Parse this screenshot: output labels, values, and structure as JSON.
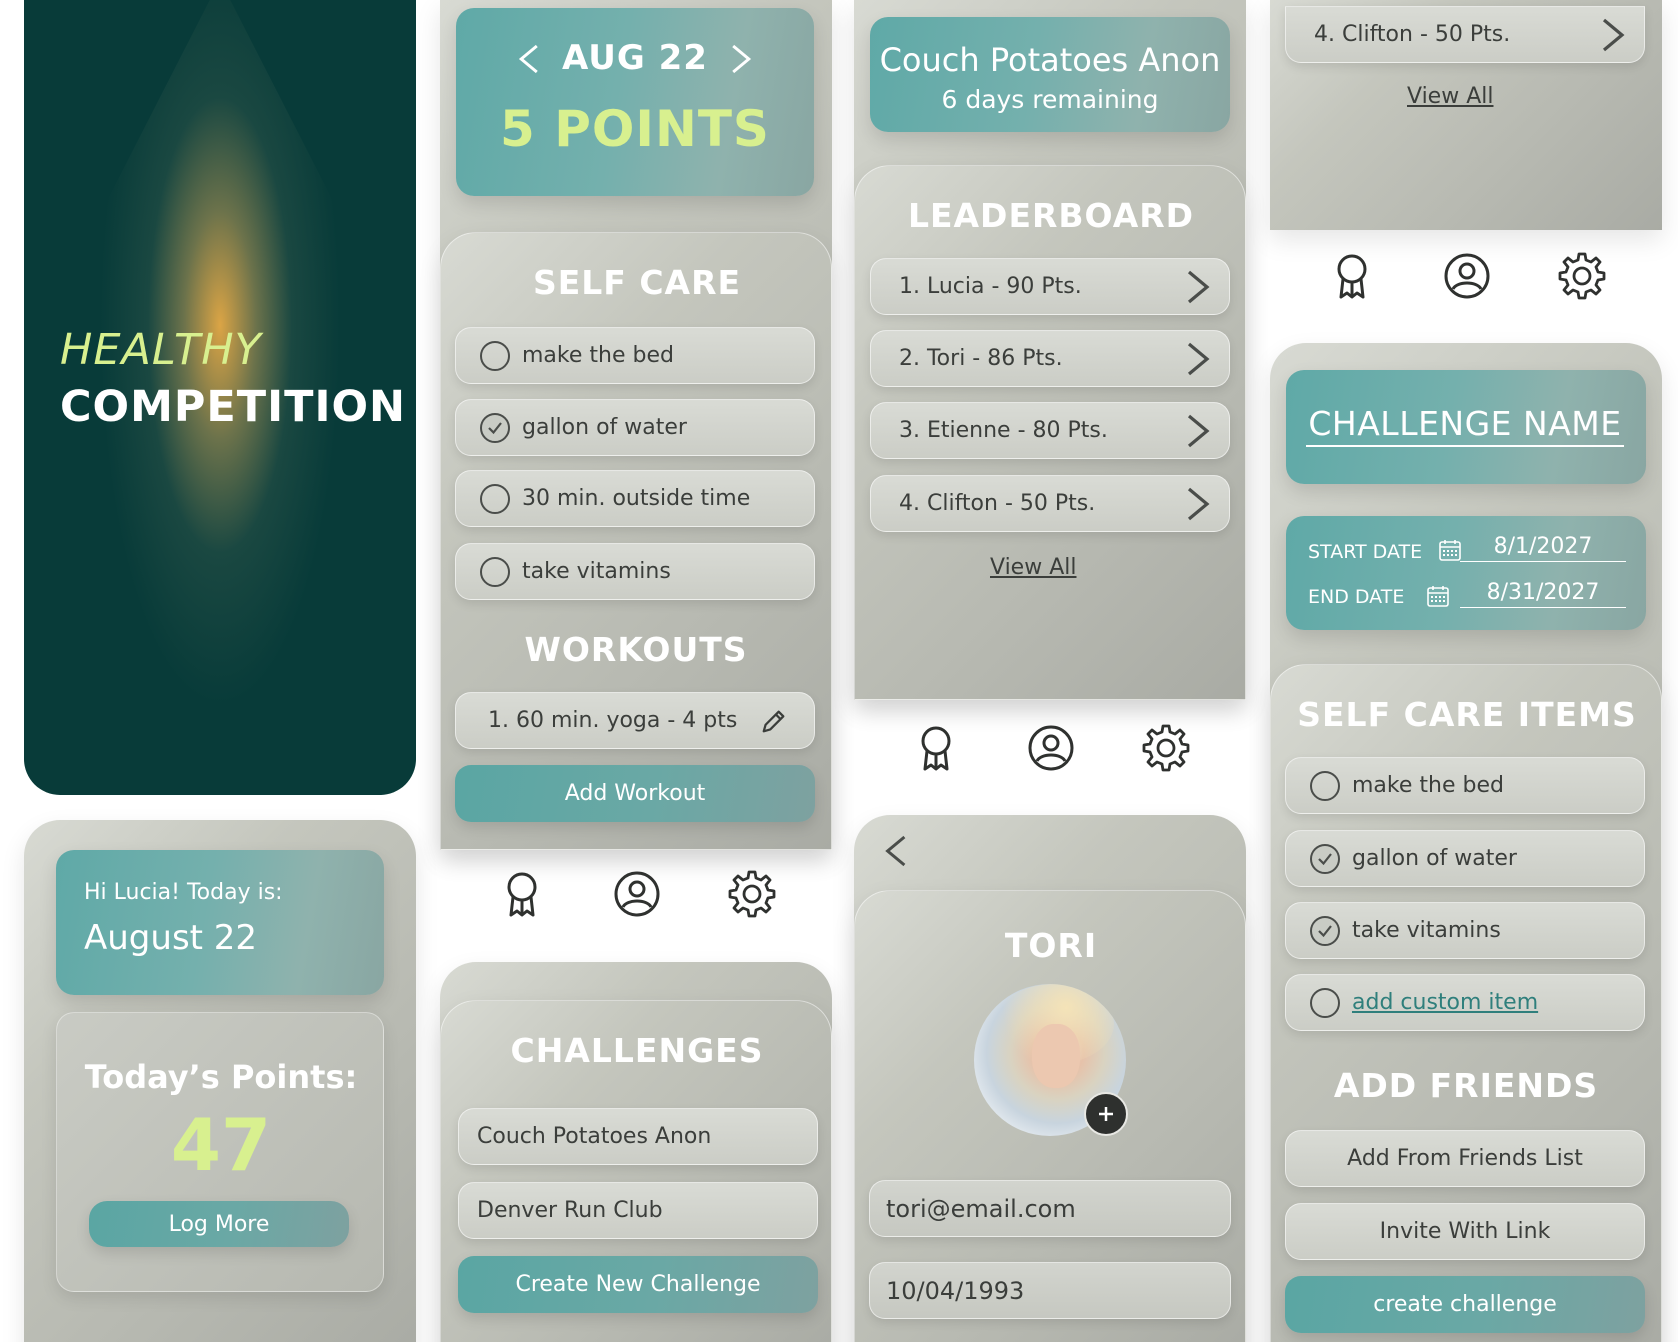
{
  "splash": {
    "title_line1": "HEALTHY",
    "title_line2": "COMPETITION"
  },
  "home": {
    "greeting": "Hi Lucia! Today is:",
    "date": "August 22",
    "points_label": "Today’s Points:",
    "points_value": "47",
    "log_more": "Log More"
  },
  "daily": {
    "date": "AUG 22",
    "points": "5 POINTS",
    "self_care_title": "SELF CARE",
    "self_care_items": [
      {
        "label": "make the bed",
        "checked": false
      },
      {
        "label": "gallon of water",
        "checked": true
      },
      {
        "label": "30 min. outside time",
        "checked": false
      },
      {
        "label": "take vitamins",
        "checked": false
      }
    ],
    "workouts_title": "WORKOUTS",
    "workouts": [
      "1. 60 min. yoga - 4 pts"
    ],
    "add_workout": "Add Workout"
  },
  "challenges": {
    "title": "CHALLENGES",
    "items": [
      "Couch Potatoes Anon",
      "Denver Run Club"
    ],
    "create": "Create New Challenge"
  },
  "challenge_view": {
    "name": "Couch Potatoes Anon",
    "remaining": "6 days remaining",
    "leaderboard_title": "LEADERBOARD",
    "leaders": [
      "1. Lucia - 90 Pts.",
      "2. Tori - 86 Pts.",
      "3. Etienne - 80 Pts.",
      "4. Clifton - 50 Pts."
    ],
    "view_all": "View All"
  },
  "profile": {
    "name": "TORI",
    "email": "tori@email.com",
    "dob": "10/04/1993"
  },
  "top_right": {
    "leader": "4. Clifton - 50 Pts.",
    "view_all": "View All"
  },
  "new_challenge": {
    "name_placeholder": "CHALLENGE NAME",
    "start_label": "START DATE",
    "start_value": "8/1/2027",
    "end_label": "END DATE",
    "end_value": "8/31/2027",
    "self_care_title": "SELF CARE ITEMS",
    "items": [
      {
        "label": "make the bed",
        "checked": false
      },
      {
        "label": "gallon of water",
        "checked": true
      },
      {
        "label": "take vitamins",
        "checked": true
      }
    ],
    "add_custom": "add custom item",
    "friends_title": "ADD FRIENDS",
    "from_list": "Add From Friends List",
    "invite": "Invite With Link",
    "create": "create challenge"
  },
  "icons": [
    "award-icon",
    "profile-icon",
    "gear-icon",
    "chevron-left-icon",
    "chevron-right-icon",
    "pencil-icon",
    "calendar-icon",
    "plus-icon",
    "check-icon"
  ],
  "colors": {
    "dark_green": "#083b39",
    "teal": "#5fa9a7",
    "lime": "#d8f08f",
    "panel_grey": "#c4c6bd"
  }
}
